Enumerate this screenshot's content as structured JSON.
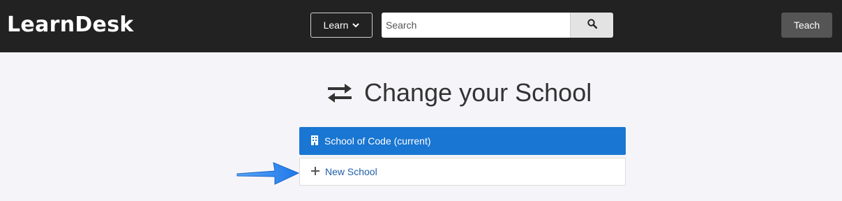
{
  "header": {
    "brand": "LearnDesk",
    "learn_label": "Learn",
    "search_placeholder": "Search",
    "teach_label": "Teach"
  },
  "main": {
    "title": "Change your School",
    "schools": {
      "current": "School of Code (current)",
      "new": "New School"
    }
  },
  "colors": {
    "header_bg": "#222222",
    "page_bg": "#f5f5f9",
    "primary": "#1976d2",
    "link": "#1f5ea8",
    "annotation_arrow": "#2f86f0"
  },
  "icons": {
    "learn_dropdown": "chevron-down-icon",
    "search": "search-icon",
    "title": "exchange-arrows-icon",
    "current_school": "building-icon",
    "new_school": "plus-icon",
    "annotation": "pointer-arrow-icon"
  }
}
